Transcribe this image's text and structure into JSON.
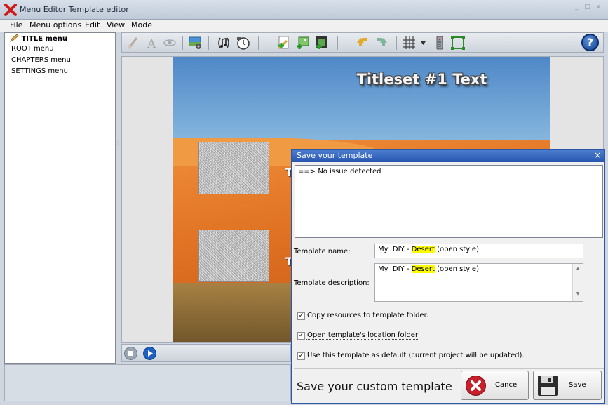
{
  "window": {
    "title": "Menu Editor Template editor",
    "controls": "_ □ x"
  },
  "menubar": {
    "items": [
      "File",
      "Menu options",
      "Edit",
      "View",
      "Mode"
    ]
  },
  "tree": {
    "items": [
      {
        "label": "TITLE menu",
        "selected": true,
        "icon": "pencil-icon"
      },
      {
        "label": "ROOT menu"
      },
      {
        "label": "CHAPTERS menu"
      },
      {
        "label": "SETTINGS menu"
      }
    ]
  },
  "toolbar": {
    "icons": [
      "brush-icon",
      "text-icon",
      "eye-icon",
      "background-settings-icon",
      "audio-icon",
      "timer-icon",
      "add-button-icon",
      "add-image-icon",
      "add-video-icon",
      "undo-icon",
      "redo-icon",
      "grid-icon",
      "remote-icon",
      "frame-icon"
    ],
    "help_label": "?"
  },
  "canvas": {
    "title": "Titleset #1 Text",
    "peek_chars": [
      "T",
      "T"
    ]
  },
  "dialog": {
    "title": "Save your template",
    "close": "×",
    "log": "==> No issue detected",
    "name_label": "Template name:",
    "name_prefix": "My  DIY - ",
    "name_highlight": "Desert",
    "name_suffix": " (open style)",
    "desc_label": "Template description:",
    "desc_prefix": "My  DIY - ",
    "desc_highlight": "Desert",
    "desc_suffix": " (open style)",
    "scroll_up": "▲",
    "scroll_down": "▼",
    "checkboxes": [
      {
        "label": "Copy resources to template folder.",
        "checked": true
      },
      {
        "label": "Open template's location folder",
        "checked": true
      },
      {
        "label": "Use this template as default (current project will be updated).",
        "checked": true
      }
    ],
    "footer_text": "Save your custom template",
    "cancel_label": "Cancel",
    "save_label": "Save",
    "check_mark": "✓"
  },
  "colors": {
    "accent": "#2656b0",
    "highlight": "#ffff00",
    "cancel": "#c8202a"
  }
}
